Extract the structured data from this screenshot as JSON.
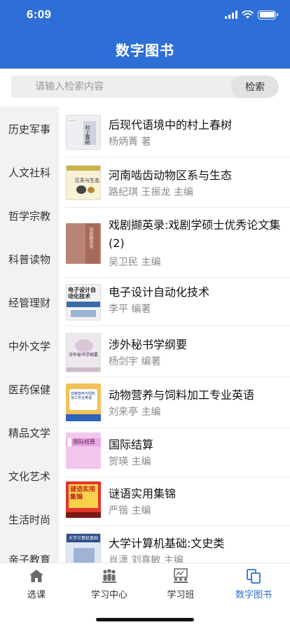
{
  "status": {
    "time": "6:09"
  },
  "header": {
    "title": "数字图书"
  },
  "search": {
    "placeholder": "请输入检索内容",
    "button_label": "检索"
  },
  "categories": [
    "历史军事",
    "人文社科",
    "哲学宗教",
    "科普读物",
    "经管理财",
    "中外文学",
    "医药保健",
    "精品文学",
    "文化艺术",
    "生活时尚",
    "亲子教育"
  ],
  "books": [
    {
      "title": "后现代语境中的村上春树",
      "author": "杨炳菁 著",
      "cover_text": "村上春树"
    },
    {
      "title": "河南啮齿动物区系与生态",
      "author": "路纪琪 王振龙 主编",
      "cover_text": "区系与生态"
    },
    {
      "title": "戏剧撷英录:戏剧学硕士优秀论文集(2)",
      "author": "吴卫民 主编",
      "cover_text": "戏剧撷英录"
    },
    {
      "title": "电子设计自动化技术",
      "author": "李平 编著",
      "cover_text": "电子设计自动化技术"
    },
    {
      "title": "涉外秘书学纲要",
      "author": "杨剑宇 编著",
      "cover_text": "涉外秘书学纲要"
    },
    {
      "title": "动物营养与饲料加工专业英语",
      "author": "刘来亭 主编",
      "cover_text": "动物营养与饲料加工专业英语"
    },
    {
      "title": "国际结算",
      "author": "贺瑛 主编",
      "cover_text": "国际结算"
    },
    {
      "title": "谜语实用集锦",
      "author": "严锴 主编",
      "cover_text": "谜语实用集锦"
    },
    {
      "title": "大学计算机基础:文史类",
      "author": "肖潇 刘喜敏 主编",
      "cover_text": "大学计算机基础"
    }
  ],
  "tabs": [
    {
      "label": "选课",
      "icon": "home-icon"
    },
    {
      "label": "学习中心",
      "icon": "people-icon"
    },
    {
      "label": "学习班",
      "icon": "classroom-icon"
    },
    {
      "label": "数字图书",
      "icon": "copy-icon",
      "active": true
    }
  ],
  "colors": {
    "primary": "#2d6fd6",
    "sidebar_bg": "#f2f2f2",
    "muted_text": "#8a8a8a"
  }
}
